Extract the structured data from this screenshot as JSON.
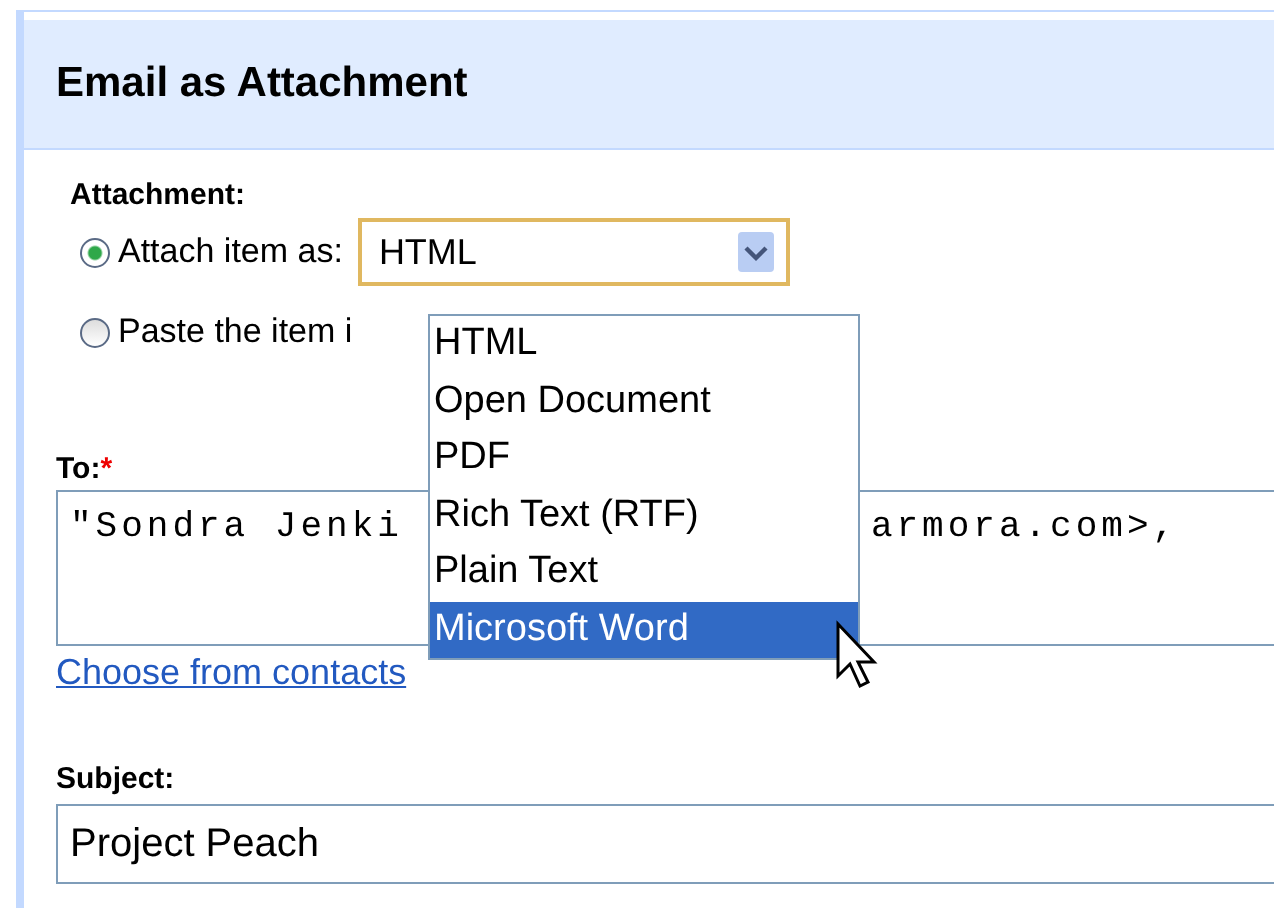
{
  "dialog": {
    "title": "Email as Attachment"
  },
  "attachment": {
    "label": "Attachment:",
    "options": [
      {
        "label": "Attach item as:",
        "selected": true
      },
      {
        "label": "Paste the item i",
        "selected": false
      }
    ],
    "format_select": {
      "value": "HTML",
      "expanded": true,
      "options": [
        {
          "label": "HTML",
          "highlighted": false
        },
        {
          "label": "Open Document",
          "highlighted": false
        },
        {
          "label": "PDF",
          "highlighted": false
        },
        {
          "label": "Rich Text (RTF)",
          "highlighted": false
        },
        {
          "label": "Plain Text",
          "highlighted": false
        },
        {
          "label": "Microsoft Word",
          "highlighted": true
        }
      ]
    }
  },
  "to": {
    "label": "To:",
    "required_mark": "*",
    "value_parts": [
      "\"Sondra Jenki",
      "armora.com>,"
    ]
  },
  "choose_contacts_link": "Choose from contacts",
  "subject": {
    "label": "Subject:",
    "value": "Project Peach"
  }
}
